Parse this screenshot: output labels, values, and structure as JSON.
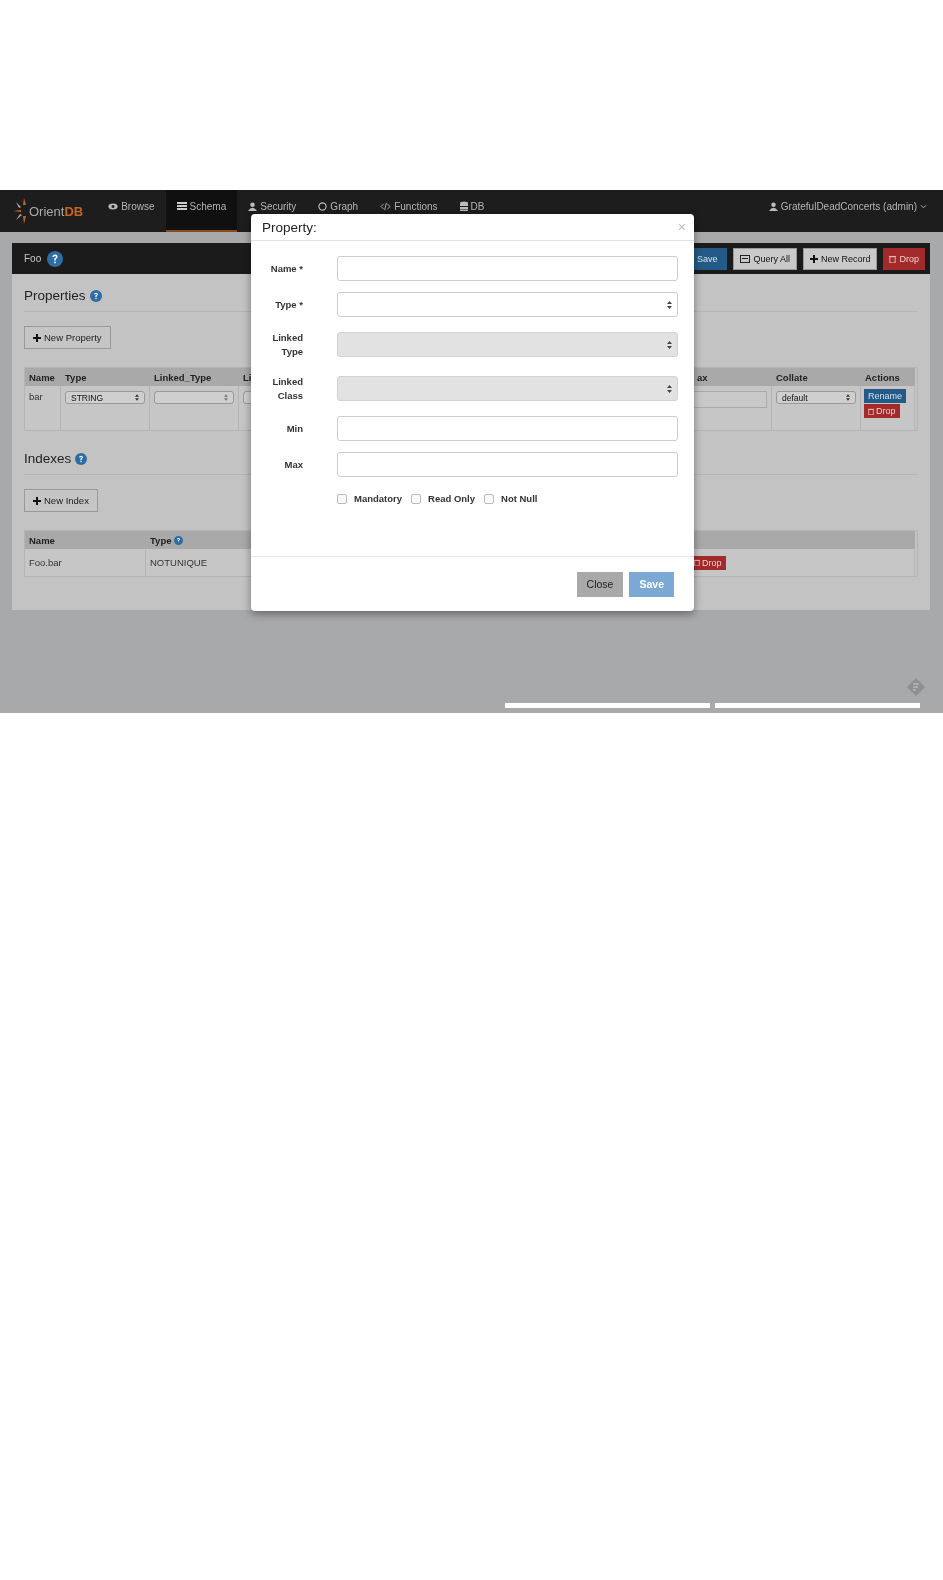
{
  "navbar": {
    "brand": {
      "name": "Orient",
      "suffix": "DB"
    },
    "items": [
      {
        "label": "Browse",
        "selected": false
      },
      {
        "label": "Schema",
        "selected": true
      },
      {
        "label": "Security",
        "selected": false
      },
      {
        "label": "Graph",
        "selected": false
      },
      {
        "label": "Functions",
        "selected": false
      },
      {
        "label": "DB",
        "selected": false
      }
    ],
    "user": "GratefulDeadConcerts (admin)"
  },
  "class_panel": {
    "title": "Foo",
    "buttons": [
      {
        "label": "Save",
        "kind": "primary"
      },
      {
        "label": "Query All",
        "kind": "query"
      },
      {
        "label": "New Record",
        "kind": "add"
      },
      {
        "label": "Drop",
        "kind": "danger"
      }
    ]
  },
  "properties": {
    "heading": "Properties",
    "new_button": "New Property",
    "columns": [
      "Name",
      "Type",
      "Linked_Type",
      "Li",
      "ax",
      "Collate",
      "Actions"
    ],
    "rows": [
      {
        "name": "bar",
        "type": "STRING",
        "collate": "default",
        "actions": [
          {
            "label": "Rename",
            "kind": "primary"
          },
          {
            "label": "Drop",
            "kind": "danger"
          }
        ]
      }
    ]
  },
  "indexes": {
    "heading": "Indexes",
    "new_button": "New Index",
    "columns": [
      "Name",
      "Type"
    ],
    "rows": [
      {
        "name": "Foo.bar",
        "type": "NOTUNIQUE",
        "action": "Drop"
      }
    ]
  },
  "modal": {
    "title": "Property:",
    "close": "×",
    "fields": [
      {
        "label": "Name *",
        "kind": "text",
        "disabled": false
      },
      {
        "label": "Type *",
        "kind": "select",
        "disabled": false
      },
      {
        "label": "Linked Type",
        "kind": "select",
        "disabled": true
      },
      {
        "label": "Linked Class",
        "kind": "select",
        "disabled": true
      },
      {
        "label": "Min",
        "kind": "text",
        "disabled": false
      },
      {
        "label": "Max",
        "kind": "text",
        "disabled": false
      }
    ],
    "checkboxes": [
      {
        "label": "Mandatory",
        "checked": false
      },
      {
        "label": "Read Only",
        "checked": false
      },
      {
        "label": "Not Null",
        "checked": false
      }
    ],
    "buttons": [
      {
        "label": "Close",
        "kind": "default"
      },
      {
        "label": "Save",
        "kind": "primary"
      }
    ]
  }
}
